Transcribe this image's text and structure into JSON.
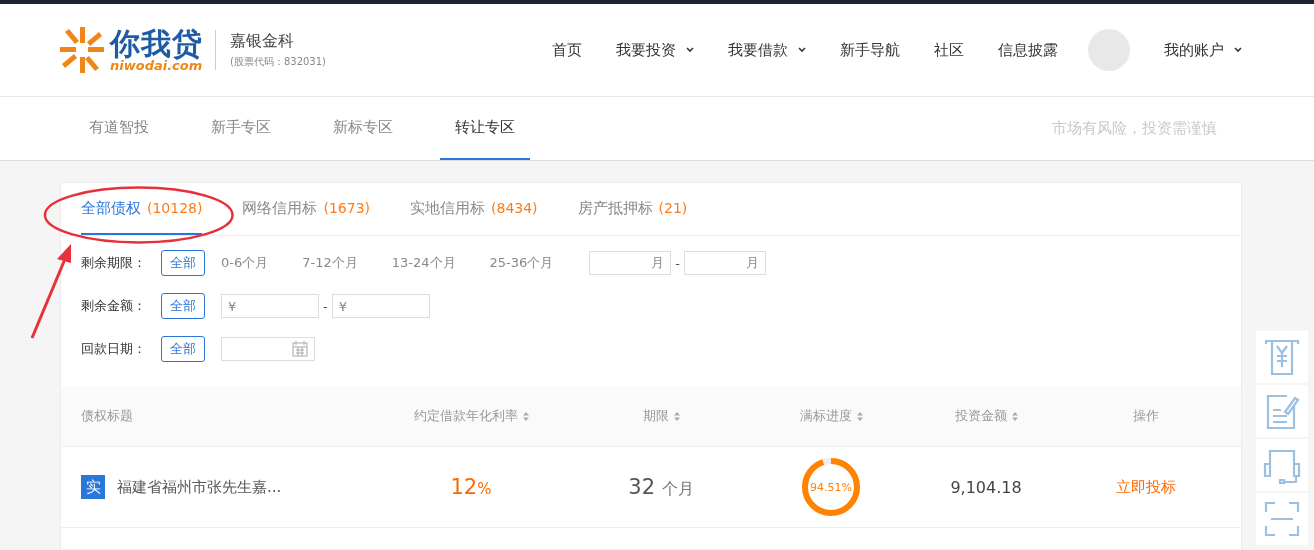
{
  "header": {
    "logo_text": "你我贷",
    "logo_domain": "niwodai.com",
    "company": "嘉银金科",
    "stock_code": "(股票代码：832031)",
    "nav": [
      {
        "label": "首页",
        "dropdown": false
      },
      {
        "label": "我要投资",
        "dropdown": true
      },
      {
        "label": "我要借款",
        "dropdown": true
      },
      {
        "label": "新手导航",
        "dropdown": false
      },
      {
        "label": "社区",
        "dropdown": false
      },
      {
        "label": "信息披露",
        "dropdown": false
      }
    ],
    "account": {
      "label": "我的账户",
      "dropdown": true
    }
  },
  "subnav": {
    "items": [
      {
        "label": "有道智投",
        "selected": false
      },
      {
        "label": "新手专区",
        "selected": false
      },
      {
        "label": "新标专区",
        "selected": false
      },
      {
        "label": "转让专区",
        "selected": true
      }
    ],
    "notice": "市场有风险，投资需谨慎"
  },
  "tabs": [
    {
      "label": "全部债权",
      "count": "(10128)",
      "selected": true
    },
    {
      "label": "网络信用标",
      "count": "(1673)",
      "selected": false
    },
    {
      "label": "实地信用标",
      "count": "(8434)",
      "selected": false
    },
    {
      "label": "房产抵押标",
      "count": "(21)",
      "selected": false
    }
  ],
  "filters": [
    {
      "kind": "term",
      "label": "剩余期限：",
      "all": "全部",
      "options": [
        "0-6个月",
        "7-12个月",
        "13-24个月",
        "25-36个月"
      ],
      "units": [
        "月",
        "月"
      ],
      "separator": "-"
    },
    {
      "kind": "amount",
      "label": "剩余金额：",
      "all": "全部",
      "prefix": "¥",
      "separator": "-"
    },
    {
      "kind": "date",
      "label": "回款日期：",
      "all": "全部"
    }
  ],
  "table": {
    "columns": [
      {
        "label": "债权标题",
        "sortable": false
      },
      {
        "label": "约定借款年化利率",
        "sortable": true
      },
      {
        "label": "期限",
        "sortable": true
      },
      {
        "label": "满标进度",
        "sortable": true
      },
      {
        "label": "投资金额",
        "sortable": true
      },
      {
        "label": "操作",
        "sortable": false
      }
    ],
    "rows": [
      {
        "badge": "实",
        "title": "福建省福州市张先生嘉...",
        "rate": "12",
        "rate_unit": "%",
        "term": "32",
        "term_unit": "个月",
        "progress": "94.51%",
        "level": 0.9451,
        "amount": "9,104.18",
        "action": "立即投标"
      }
    ]
  },
  "annotation": {
    "highlight": true
  }
}
